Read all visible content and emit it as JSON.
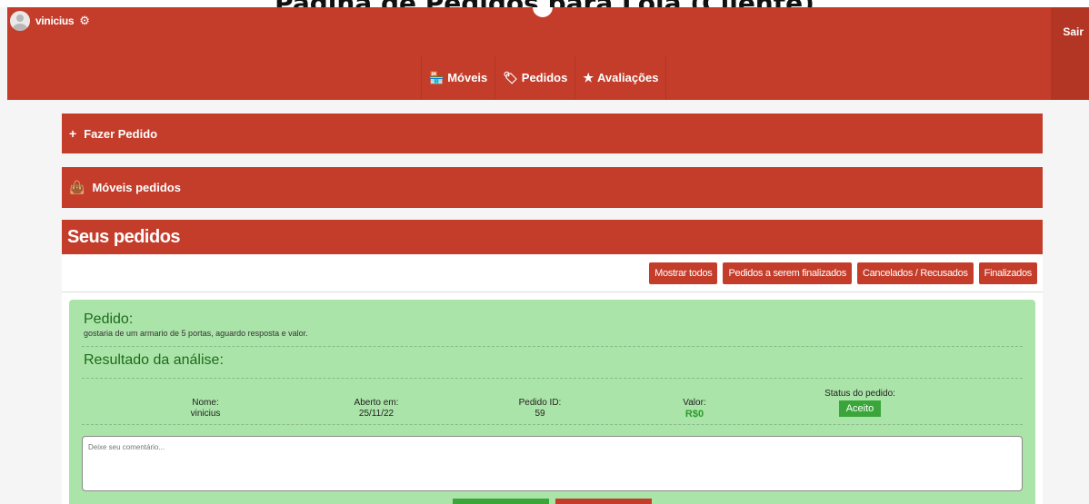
{
  "page_title": "Página de Pedidos para Loja (Cliente)",
  "header": {
    "username": "vinicius",
    "logout_label": "Sair",
    "nav": [
      {
        "label": "Móveis",
        "icon": "store-icon"
      },
      {
        "label": "Pedidos",
        "icon": "tag-icon"
      },
      {
        "label": "Avaliações",
        "icon": "star-icon"
      }
    ]
  },
  "panels": {
    "new_order": "Fazer Pedido",
    "ordered_furniture": "Móveis pedidos"
  },
  "orders": {
    "title": "Seus pedidos",
    "filters": [
      "Mostrar todos",
      "Pedidos a serem finalizados",
      "Cancelados / Recusados",
      "Finalizados"
    ]
  },
  "order": {
    "heading": "Pedido:",
    "description": "gostaria de um armario de 5 portas, aguardo resposta e valor.",
    "result_heading": "Resultado da análise:",
    "name_label": "Nome:",
    "name_value": "vinicius",
    "opened_label": "Aberto em:",
    "opened_value": "25/11/22",
    "id_label": "Pedido ID:",
    "id_value": "59",
    "value_label": "Valor:",
    "value_value": "R$0",
    "status_label": "Status do pedido:",
    "status_value": "Aceito",
    "comment_placeholder": "Deixe seu comentário..."
  },
  "colors": {
    "brand": "#c43d2b",
    "card_bg": "#abe4a9",
    "success": "#3aa63a",
    "heading_green": "#1d6b1d"
  }
}
